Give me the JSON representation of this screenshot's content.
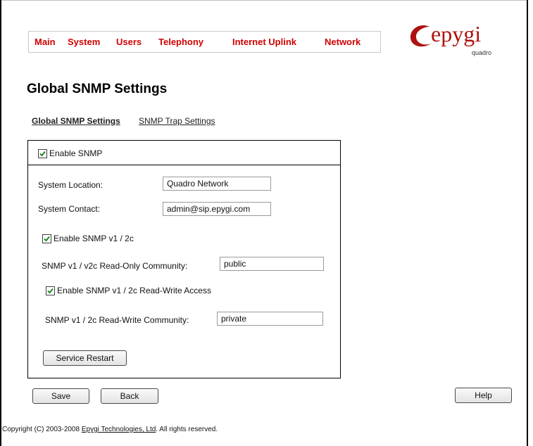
{
  "nav": {
    "items": [
      "Main",
      "System",
      "Users",
      "Telephony",
      "Internet Uplink",
      "Network"
    ]
  },
  "logo": {
    "word": "epygi",
    "sub": "quadro"
  },
  "page": {
    "title": "Global SNMP Settings"
  },
  "subnav": {
    "global": "Global SNMP Settings",
    "trap": "SNMP Trap Settings"
  },
  "form": {
    "enable_snmp": {
      "label": "Enable SNMP",
      "checked": true
    },
    "system_location": {
      "label": "System Location:",
      "value": "Quadro Network"
    },
    "system_contact": {
      "label": "System Contact:",
      "value": "admin@sip.epygi.com"
    },
    "enable_v1v2c": {
      "label": "Enable SNMP v1 / 2c",
      "checked": true
    },
    "ro_community": {
      "label": "SNMP v1 / v2c Read-Only Community:",
      "value": "public"
    },
    "enable_rw": {
      "label": "Enable SNMP v1 / 2c Read-Write Access",
      "checked": true
    },
    "rw_community": {
      "label": "SNMP v1 / 2c Read-Write Community:",
      "value": "private"
    },
    "service_restart": "Service Restart"
  },
  "buttons": {
    "save": "Save",
    "back": "Back",
    "help": "Help"
  },
  "footer": {
    "prefix": "Copyright (C) 2003-2008 ",
    "link": "Epygi Technologies, Ltd",
    "suffix": ". All rights reserved."
  },
  "colors": {
    "nav_text": "#d00000",
    "logo": "#b01010"
  }
}
